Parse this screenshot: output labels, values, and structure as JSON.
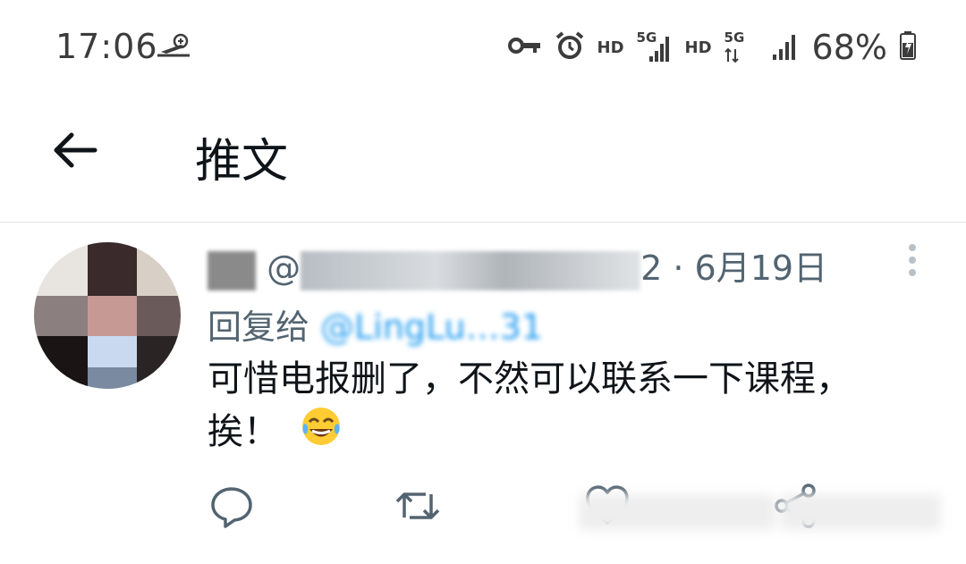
{
  "status_bar": {
    "time": "17:06",
    "left_icon": "airplane-mode-icon",
    "icons": [
      "key-icon",
      "alarm-icon"
    ],
    "network1_hd": "HD",
    "network1_gen": "5G",
    "network2_hd": "HD",
    "network2_gen": "5G",
    "battery_percent": "68%"
  },
  "header": {
    "title": "推文",
    "back_icon": "arrow-left-icon"
  },
  "tweet": {
    "author_handle_visible": "@",
    "author_handle_tail": "2",
    "date": "· 6月19日",
    "reply_to_label": "回复给",
    "reply_to_handle": "@LingLu…31",
    "text_line1": "可惜电报删了，不然可以联系一下课程，",
    "text_line2": "挨！",
    "emoji": "tears-of-joy-emoji",
    "more_icon": "more-vertical-icon",
    "actions": [
      "reply-icon",
      "retweet-icon",
      "like-icon",
      "share-icon"
    ]
  },
  "colors": {
    "text_primary": "#0f1419",
    "text_secondary": "#536471",
    "accent": "#1d9bf0",
    "divider": "#dfe3e6"
  }
}
